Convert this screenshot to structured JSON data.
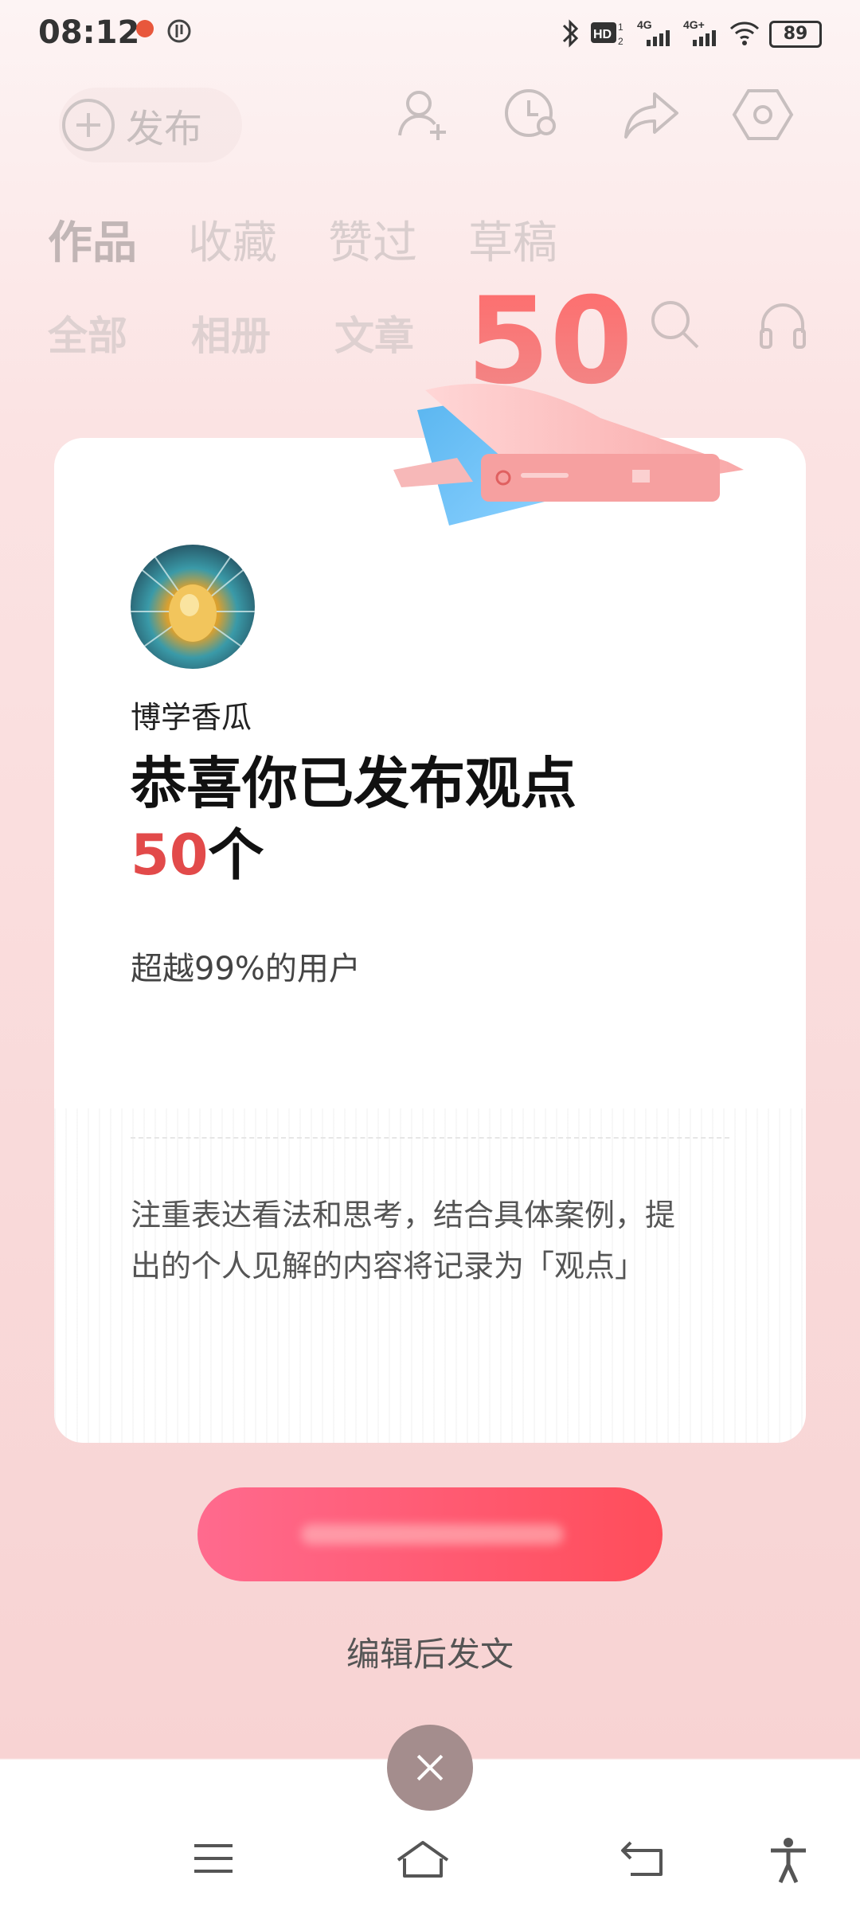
{
  "status_bar": {
    "time": "08:12",
    "battery": "89"
  },
  "background_page": {
    "publish_label": "发布",
    "tabs": [
      "作品",
      "收藏",
      "赞过",
      "草稿"
    ],
    "subtabs": [
      "全部",
      "相册",
      "文章"
    ]
  },
  "badge": {
    "number": "50"
  },
  "card": {
    "username": "博学香瓜",
    "congrats": "恭喜你已发布观点",
    "count": "50",
    "count_unit": "个",
    "beat_text": "超越99%的用户",
    "description": "注重表达看法和思考，结合具体案例，提出的个人见解的内容将记录为「观点」"
  },
  "actions": {
    "edit_link": "编辑后发文"
  },
  "colors": {
    "accent": "#e24a4a",
    "button_start": "#ff6a8e",
    "button_end": "#ff4d5a"
  }
}
